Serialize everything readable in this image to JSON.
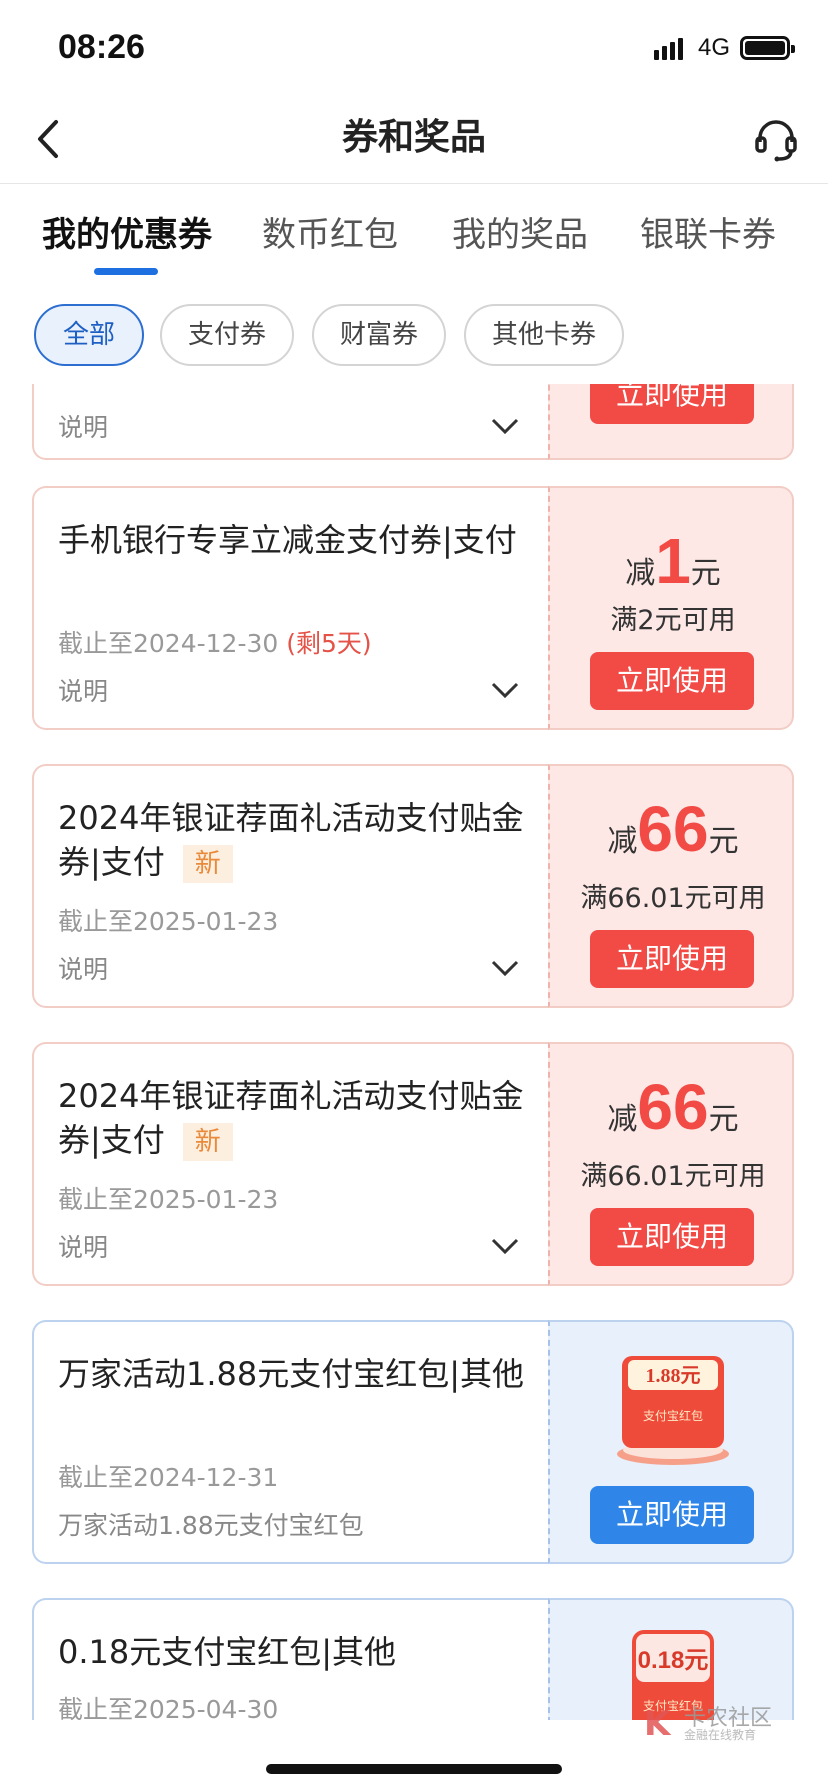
{
  "status_bar": {
    "time": "08:26",
    "network": "4G"
  },
  "nav": {
    "title": "券和奖品"
  },
  "tabs": [
    {
      "label": "我的优惠券",
      "active": true
    },
    {
      "label": "数币红包",
      "active": false
    },
    {
      "label": "我的奖品",
      "active": false
    },
    {
      "label": "银联卡券",
      "active": false
    }
  ],
  "filters": [
    {
      "label": "全部",
      "active": true
    },
    {
      "label": "支付券",
      "active": false
    },
    {
      "label": "财富券",
      "active": false
    },
    {
      "label": "其他卡券",
      "active": false
    }
  ],
  "partial_card": {
    "desc": "说明",
    "button": "立即使用"
  },
  "coupons": [
    {
      "title": "手机银行专享立减金支付券|支付",
      "new_badge": "",
      "deadline": "截止至2024-12-30",
      "remaining": "(剩5天)",
      "desc": "说明",
      "prefix": "减",
      "amount": "1",
      "unit": "元",
      "condition": "满2元可用",
      "button": "立即使用",
      "theme": "red"
    },
    {
      "title": "2024年银证荐面礼活动支付贴金券|支付",
      "new_badge": "新",
      "deadline": "截止至2025-01-23",
      "remaining": "",
      "desc": "说明",
      "prefix": "减",
      "amount": "66",
      "unit": "元",
      "condition": "满66.01元可用",
      "button": "立即使用",
      "theme": "red"
    },
    {
      "title": "2024年银证荐面礼活动支付贴金券|支付",
      "new_badge": "新",
      "deadline": "截止至2025-01-23",
      "remaining": "",
      "desc": "说明",
      "prefix": "减",
      "amount": "66",
      "unit": "元",
      "condition": "满66.01元可用",
      "button": "立即使用",
      "theme": "red"
    },
    {
      "title": "万家活动1.88元支付宝红包|其他",
      "new_badge": "",
      "deadline": "截止至2024-12-31",
      "remaining": "",
      "desc": "万家活动1.88元支付宝红包",
      "packet_value": "1.88元",
      "packet_label": "支付宝红包",
      "button": "立即使用",
      "theme": "blue"
    },
    {
      "title": "0.18元支付宝红包|其他",
      "new_badge": "",
      "deadline": "截止至2025-04-30",
      "remaining": "",
      "desc": "",
      "packet_value": "0.18元",
      "packet_label": "支付宝红包",
      "button": "",
      "theme": "blue"
    }
  ],
  "watermark": {
    "text": "卡农社区",
    "sub": "金融在线教育"
  }
}
